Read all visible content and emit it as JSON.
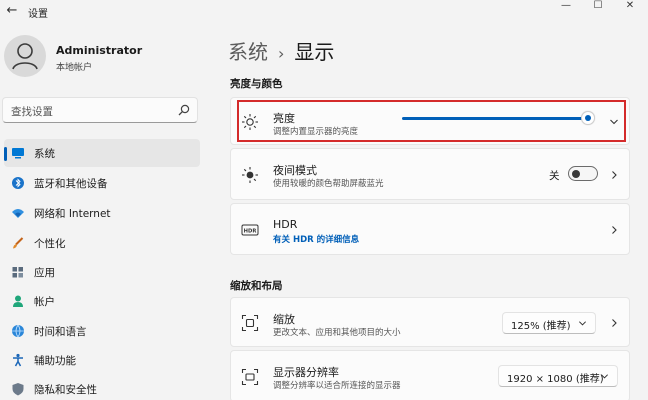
{
  "window": {
    "title": "设置",
    "back_glyph": "←",
    "minimize_glyph": "—",
    "maximize_glyph": "☐",
    "close_glyph": "✕"
  },
  "user": {
    "name": "Administrator",
    "account_type": "本地帐户"
  },
  "search": {
    "placeholder": "查找设置"
  },
  "sidebar": {
    "items": [
      {
        "label": "系统",
        "icon": "system-display-icon",
        "selected": true
      },
      {
        "label": "蓝牙和其他设备",
        "icon": "bluetooth-icon",
        "selected": false
      },
      {
        "label": "网络和 Internet",
        "icon": "wifi-icon",
        "selected": false
      },
      {
        "label": "个性化",
        "icon": "brush-icon",
        "selected": false
      },
      {
        "label": "应用",
        "icon": "apps-icon",
        "selected": false
      },
      {
        "label": "帐户",
        "icon": "person-icon",
        "selected": false
      },
      {
        "label": "时间和语言",
        "icon": "globe-clock-icon",
        "selected": false
      },
      {
        "label": "辅助功能",
        "icon": "accessibility-icon",
        "selected": false
      },
      {
        "label": "隐私和安全性",
        "icon": "shield-icon",
        "selected": false
      }
    ]
  },
  "breadcrumb": {
    "parent": "系统",
    "separator": "›",
    "current": "显示"
  },
  "sections": {
    "brightness_color": "亮度与颜色",
    "scale_layout": "缩放和布局"
  },
  "cards": {
    "brightness": {
      "title": "亮度",
      "subtitle": "调整内置显示器的亮度",
      "value_percent": 98
    },
    "night_light": {
      "title": "夜间模式",
      "subtitle": "使用较暖的颜色帮助屏蔽蓝光",
      "toggle_label": "关",
      "toggle_on": false
    },
    "hdr": {
      "title": "HDR",
      "link": "有关 HDR 的详细信息",
      "icon_text": "HDR"
    },
    "scale": {
      "title": "缩放",
      "subtitle": "更改文本、应用和其他项目的大小",
      "value": "125% (推荐)"
    },
    "resolution": {
      "title": "显示器分辨率",
      "subtitle": "调整分辨率以适合所连接的显示器",
      "value": "1920 × 1080 (推荐)"
    }
  },
  "colors": {
    "accent": "#005fb8",
    "highlight_box": "#d42b2b",
    "background": "#f3f3f3",
    "card": "#fbfbfb"
  }
}
